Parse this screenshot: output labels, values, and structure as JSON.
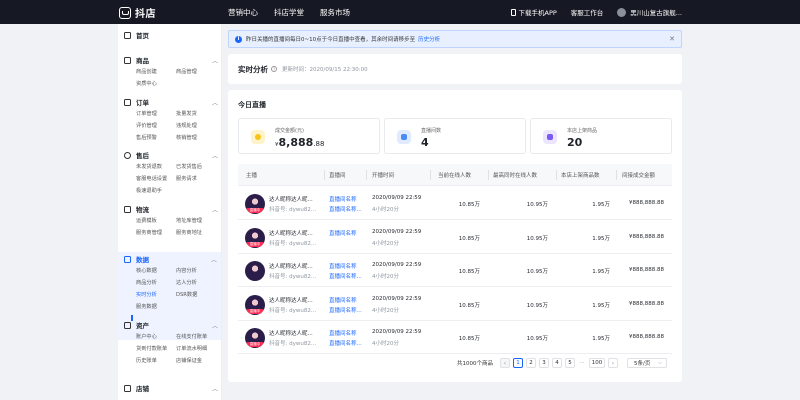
{
  "topbar": {
    "logo_text": "抖店",
    "nav": [
      "营销中心",
      "抖店学堂",
      "服务市场"
    ],
    "download_app": "下载手机APP",
    "service": "客服工作台",
    "shop_name": "黑川山复古旗舰..."
  },
  "sidebar": {
    "home": "首页",
    "sections": [
      {
        "title": "商品",
        "items": [
          "商品创建",
          "商品管理",
          "资质中心"
        ]
      },
      {
        "title": "订单",
        "items": [
          "订单管理",
          "批量发货",
          "评价管理",
          "违规处理",
          "售后预警",
          "核销管理"
        ]
      },
      {
        "title": "售后",
        "items": [
          "未发货退款",
          "已发货售后",
          "客服电话设置",
          "服务请求",
          "极速退助手"
        ]
      },
      {
        "title": "物流",
        "items": [
          "运费模板",
          "地址库管理",
          "服务商管理",
          "服务商地址"
        ]
      },
      {
        "title": "数据",
        "items": [
          "核心数据",
          "商品分析",
          "内容分析",
          "达人分析",
          "实时分析",
          "DSR数据",
          "服务数据"
        ],
        "active": "实时分析"
      },
      {
        "title": "资产",
        "items": [
          "账户中心",
          "在线支付账单",
          "货到付款账单",
          "订单流水明细",
          "历史账单",
          "店铺保证金"
        ]
      },
      {
        "title": "店铺",
        "items": []
      }
    ]
  },
  "notice": {
    "text": "昨日关播的直播间每日0~10点于今日直播中查看，其余时间请移步至",
    "link": "历史分析"
  },
  "realtime": {
    "title": "实时分析",
    "update_time": "更新时间：2020/09/15 22:30:00"
  },
  "live": {
    "title": "今日直播",
    "stats": [
      {
        "label": "成交金额(元)",
        "prefix": "¥",
        "value": "8,888",
        "cents": ".88",
        "color": "#f5b800",
        "bg": "#fff6d9"
      },
      {
        "label": "直播间数",
        "prefix": "",
        "value": "4",
        "cents": "",
        "color": "#4b8bf5",
        "bg": "#e6efff"
      },
      {
        "label": "本店上架商品",
        "prefix": "",
        "value": "20",
        "cents": "",
        "color": "#7a5af0",
        "bg": "#efe9ff"
      }
    ],
    "columns": [
      "主播",
      "直播间",
      "开播时间",
      "当前在线人数",
      "最高同时在线人数",
      "本店上架商品数",
      "间接成交金额"
    ],
    "rows": [
      {
        "name": "达人昵称达人昵...",
        "id": "抖音号: dywu82...",
        "room1": "直播间名称",
        "room2": "直播间名称...",
        "start": "2020/09/09 22:59",
        "duration": "4小时20分",
        "online": "10.85万",
        "peak": "10.95万",
        "goods": "1.95万",
        "amount": "¥888,888.88",
        "badge": "直播中"
      },
      {
        "name": "达人昵称达人昵...",
        "id": "抖音号: dywu82...",
        "room1": "直播间名称",
        "room2": "",
        "start": "2020/09/09 22:59",
        "duration": "4小时20分",
        "online": "10.85万",
        "peak": "10.95万",
        "goods": "1.95万",
        "amount": "¥888,888.88",
        "badge": "直播中"
      },
      {
        "name": "达人昵称达人昵...",
        "id": "抖音号: dywu82...",
        "room1": "直播间名称",
        "room2": "直播间名称...",
        "start": "2020/09/09 22:59",
        "duration": "4小时20分",
        "online": "10.85万",
        "peak": "10.95万",
        "goods": "1.95万",
        "amount": "¥888,888.88",
        "badge": ""
      },
      {
        "name": "达人昵称达人昵...",
        "id": "抖音号: dywu82...",
        "room1": "直播间名称",
        "room2": "直播间名称...",
        "start": "2020/09/09 22:59",
        "duration": "4小时20分",
        "online": "10.85万",
        "peak": "10.95万",
        "goods": "1.95万",
        "amount": "¥888,888.88",
        "badge": "直播中"
      },
      {
        "name": "达人昵称达人昵...",
        "id": "抖音号: dywu82...",
        "room1": "直播间名称",
        "room2": "直播间名称...",
        "start": "2020/09/09 22:59",
        "duration": "4小时20分",
        "online": "10.85万",
        "peak": "10.95万",
        "goods": "1.95万",
        "amount": "¥888,888.88",
        "badge": "直播中"
      }
    ],
    "pagination": {
      "total": "共1000个商品",
      "pages": [
        "1",
        "2",
        "3",
        "4",
        "5"
      ],
      "current": "1",
      "ellipsis": "···",
      "last": "100",
      "page_size": "5条/页"
    }
  }
}
